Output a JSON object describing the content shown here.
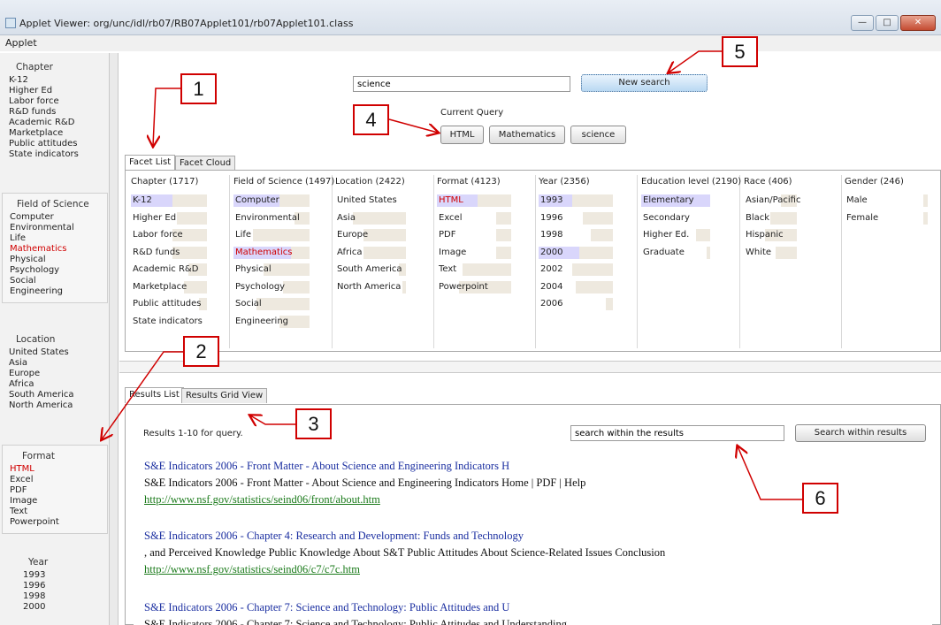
{
  "window": {
    "title": "Applet Viewer: org/unc/idl/rb07/RB07Applet101/rb07Applet101.class",
    "menu": "Applet"
  },
  "sidebar": {
    "chapter": {
      "heading": "Chapter",
      "items": [
        "K-12",
        "Higher Ed",
        "Labor force",
        "R&D funds",
        "Academic R&D",
        "Marketplace",
        "Public attitudes",
        "State indicators"
      ]
    },
    "field": {
      "heading": "Field of Science",
      "items": [
        "Computer",
        "Environmental",
        "Life",
        "Mathematics",
        "Physical",
        "Psychology",
        "Social",
        "Engineering"
      ],
      "selected": "Mathematics"
    },
    "location": {
      "heading": "Location",
      "items": [
        "United States",
        "Asia",
        "Europe",
        "Africa",
        "South America",
        "North America"
      ]
    },
    "format": {
      "heading": "Format",
      "items": [
        "HTML",
        "Excel",
        "PDF",
        "Image",
        "Text",
        "Powerpoint"
      ],
      "selected": "HTML"
    },
    "year": {
      "heading": "Year",
      "items": [
        "1993",
        "1996",
        "1998",
        "2000"
      ]
    }
  },
  "search": {
    "value": "science",
    "button": "New search"
  },
  "current_query": {
    "label": "Current Query",
    "terms": [
      "HTML",
      "Mathematics",
      "science"
    ]
  },
  "facet_tabs": [
    "Facet List",
    "Facet Cloud"
  ],
  "facets": [
    {
      "heading": "Chapter (1717)",
      "items": [
        {
          "label": "K-12",
          "level": 0.55,
          "blue": true
        },
        {
          "label": "Higher Ed",
          "level": 0.6
        },
        {
          "label": "Labor force",
          "level": 0.55
        },
        {
          "label": "R&D funds",
          "level": 0.55
        },
        {
          "label": "Academic R&D",
          "level": 0.75
        },
        {
          "label": "Marketplace",
          "level": 0.7
        },
        {
          "label": "Public attitudes",
          "level": 0.9
        },
        {
          "label": "State indicators",
          "level": 1.0
        }
      ]
    },
    {
      "heading": "Field of Science (1497)",
      "items": [
        {
          "label": "Computer",
          "level": 0.6,
          "blue": true
        },
        {
          "label": "Environmental",
          "level": 0.8
        },
        {
          "label": "Life",
          "level": 0.25
        },
        {
          "label": "Mathematics",
          "level": 0.75,
          "blue": true,
          "selected": true
        },
        {
          "label": "Physical",
          "level": 0.4
        },
        {
          "label": "Psychology",
          "level": 0.65
        },
        {
          "label": "Social",
          "level": 0.3
        },
        {
          "label": "Engineering",
          "level": 0.6
        }
      ]
    },
    {
      "heading": "Location (2422)",
      "items": [
        {
          "label": "United States",
          "level": 1.0
        },
        {
          "label": "Asia",
          "level": 0.25
        },
        {
          "label": "Europe",
          "level": 0.4
        },
        {
          "label": "Africa",
          "level": 0.4
        },
        {
          "label": "South America",
          "level": 0.9
        },
        {
          "label": "North America",
          "level": 0.95
        }
      ]
    },
    {
      "heading": "Format (4123)",
      "items": [
        {
          "label": "HTML",
          "level": 0.55,
          "blue": true,
          "selected": true
        },
        {
          "label": "Excel",
          "level": 0.8
        },
        {
          "label": "PDF",
          "level": 0.8
        },
        {
          "label": "Image",
          "level": 0.8
        },
        {
          "label": "Text",
          "level": 0.35
        },
        {
          "label": "Powerpoint",
          "level": 0.3
        }
      ]
    },
    {
      "heading": "Year (2356)",
      "items": [
        {
          "label": "1993",
          "level": 0.45,
          "blue": true
        },
        {
          "label": "1996",
          "level": 0.6
        },
        {
          "label": "1998",
          "level": 0.7
        },
        {
          "label": "2000",
          "level": 0.55,
          "blue": true
        },
        {
          "label": "2002",
          "level": 0.45
        },
        {
          "label": "2004",
          "level": 0.5
        },
        {
          "label": "2006",
          "level": 0.9
        }
      ]
    },
    {
      "heading": "Education level (2190)",
      "items": [
        {
          "label": "Elementary",
          "level": 1.0,
          "blue": true
        },
        {
          "label": "Secondary",
          "level": 1.0
        },
        {
          "label": "Higher Ed.",
          "level": 0.8
        },
        {
          "label": "Graduate",
          "level": 0.95
        }
      ]
    },
    {
      "heading": "Race (406)",
      "items": [
        {
          "label": "Asian/Pacific",
          "level": 0.7
        },
        {
          "label": "Black",
          "level": 0.5
        },
        {
          "label": "Hispanic",
          "level": 0.4
        },
        {
          "label": "White",
          "level": 0.6
        }
      ]
    },
    {
      "heading": "Gender (246)",
      "items": [
        {
          "label": "Male",
          "level": 0.95
        },
        {
          "label": "Female",
          "level": 0.95
        }
      ]
    }
  ],
  "results_tabs": [
    "Results List",
    "Results Grid View"
  ],
  "results": {
    "count_text": "Results 1-10 for query.",
    "within_placeholder": "search within the results",
    "within_button": "Search within results",
    "items": [
      {
        "title": "S&E Indicators 2006 - Front Matter - About Science and Engineering Indicators H",
        "snippet": "S&E Indicators 2006 - Front Matter - About Science and Engineering Indicators Home | PDF | Help",
        "url": "http://www.nsf.gov/statistics/seind06/front/about.htm"
      },
      {
        "title": "S&E Indicators 2006 - Chapter 4: Research and Development: Funds and Technology",
        "snippet": ", and Perceived Knowledge Public Knowledge About S&T Public Attitudes About Science-Related Issues Conclusion",
        "url": "http://www.nsf.gov/statistics/seind06/c7/c7c.htm"
      },
      {
        "title": "S&E Indicators 2006 - Chapter 7: Science and Technology: Public Attitudes and U",
        "snippet": "S&E Indicators 2006 - Chapter 7: Science and Technology: Public Attitudes and Understanding",
        "url": ""
      }
    ]
  },
  "callouts": [
    "1",
    "2",
    "3",
    "4",
    "5",
    "6"
  ],
  "colors": {
    "accent": "#d00000",
    "link": "#1a2ea0",
    "url": "#1a7a1a",
    "bar_blue": "#d9d6fb",
    "bar_tan": "#eee9df"
  }
}
